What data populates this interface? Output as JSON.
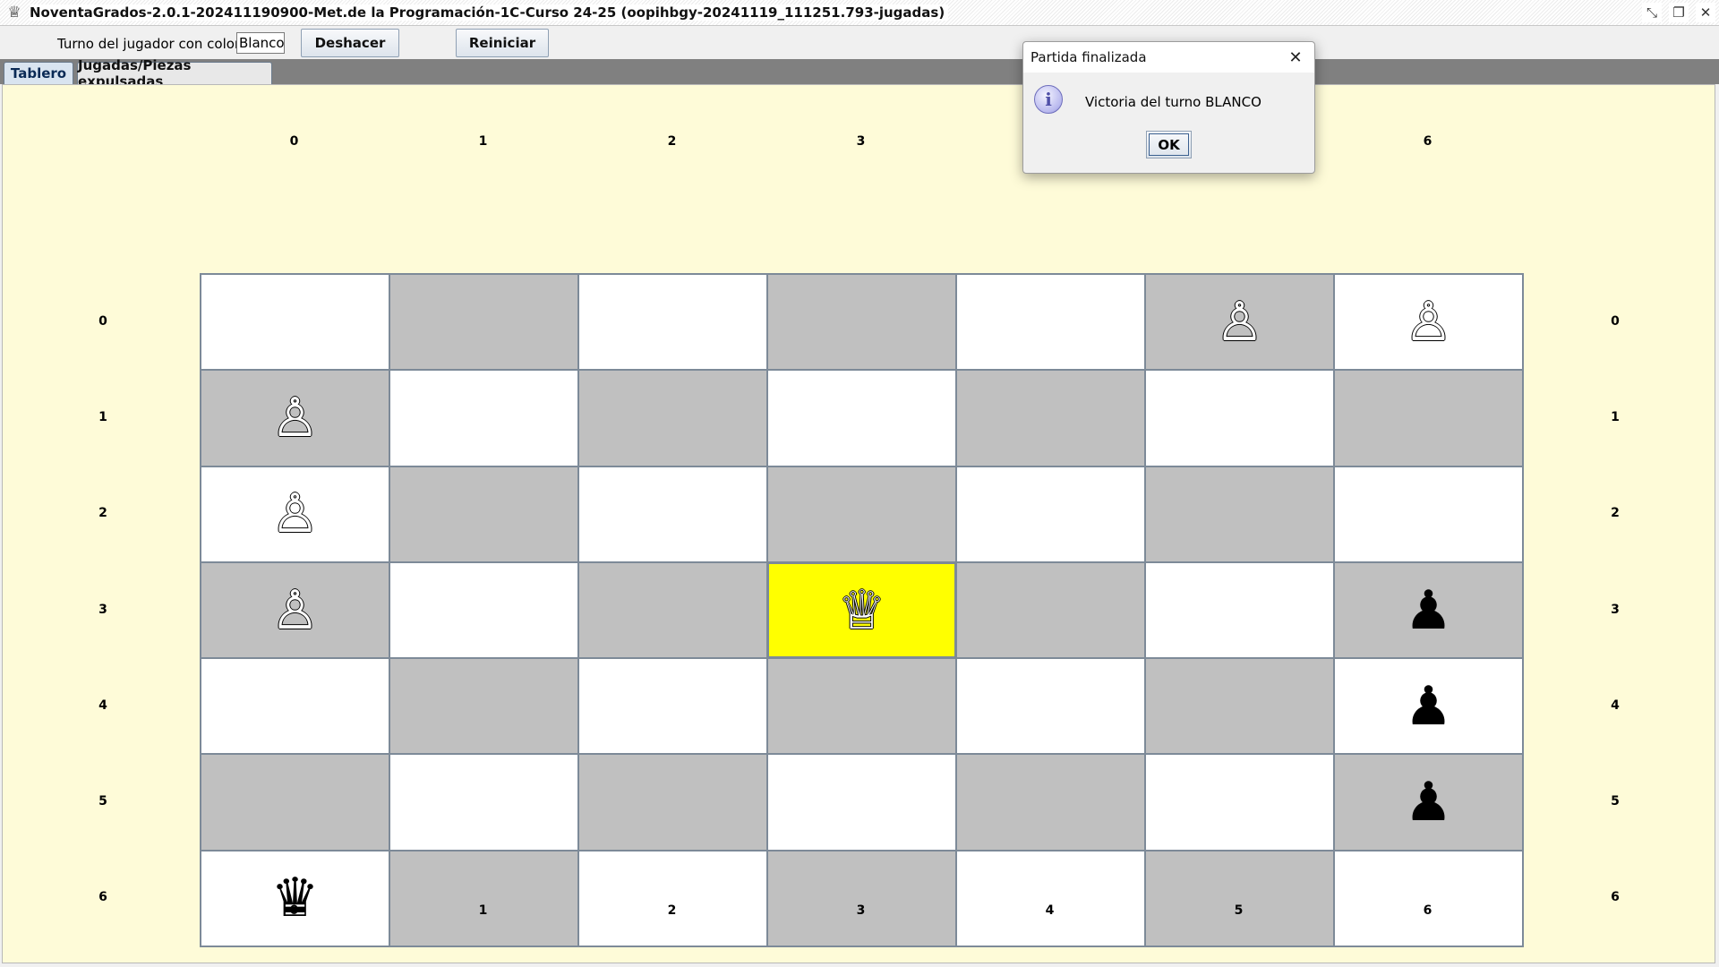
{
  "window": {
    "title": "NoventaGrados-2.0.1-202411190900-Met.de la Programación-1C-Curso 24-25 (oopihbgy-20241119_111251.793-jugadas)",
    "icon": "queen-icon",
    "controls": {
      "minimize": "⤡",
      "restore": "❐",
      "close": "✕"
    }
  },
  "toolbar": {
    "turn_label": "Turno del jugador con color:",
    "turn_value": "Blanco",
    "undo_label": "Deshacer",
    "reset_label": "Reiniciar"
  },
  "tabs": [
    {
      "label": "Tablero",
      "active": true
    },
    {
      "label": "Jugadas/Piezas expulsadas",
      "active": false
    }
  ],
  "board": {
    "columns": [
      "0",
      "1",
      "2",
      "3",
      "4",
      "5",
      "6"
    ],
    "rows": [
      "0",
      "1",
      "2",
      "3",
      "4",
      "5",
      "6"
    ],
    "selected_cell": [
      3,
      3
    ],
    "colors": {
      "light": "#ffffff",
      "dark": "#c0c0c0",
      "selected": "#ffff00",
      "background": "#fefbd8"
    },
    "pieces": [
      {
        "row": 0,
        "col": 5,
        "type": "pawn",
        "color": "white"
      },
      {
        "row": 0,
        "col": 6,
        "type": "pawn",
        "color": "white"
      },
      {
        "row": 1,
        "col": 0,
        "type": "pawn",
        "color": "white"
      },
      {
        "row": 2,
        "col": 0,
        "type": "pawn",
        "color": "white"
      },
      {
        "row": 3,
        "col": 0,
        "type": "pawn",
        "color": "white"
      },
      {
        "row": 3,
        "col": 3,
        "type": "queen",
        "color": "white"
      },
      {
        "row": 3,
        "col": 6,
        "type": "pawn",
        "color": "black"
      },
      {
        "row": 4,
        "col": 6,
        "type": "pawn",
        "color": "black"
      },
      {
        "row": 5,
        "col": 6,
        "type": "pawn",
        "color": "black"
      },
      {
        "row": 6,
        "col": 0,
        "type": "queen",
        "color": "black"
      }
    ]
  },
  "dialog": {
    "title": "Partida finalizada",
    "close": "✕",
    "icon": "info-icon",
    "icon_glyph": "i",
    "message": "Victoria del turno BLANCO",
    "ok_label": "OK"
  }
}
